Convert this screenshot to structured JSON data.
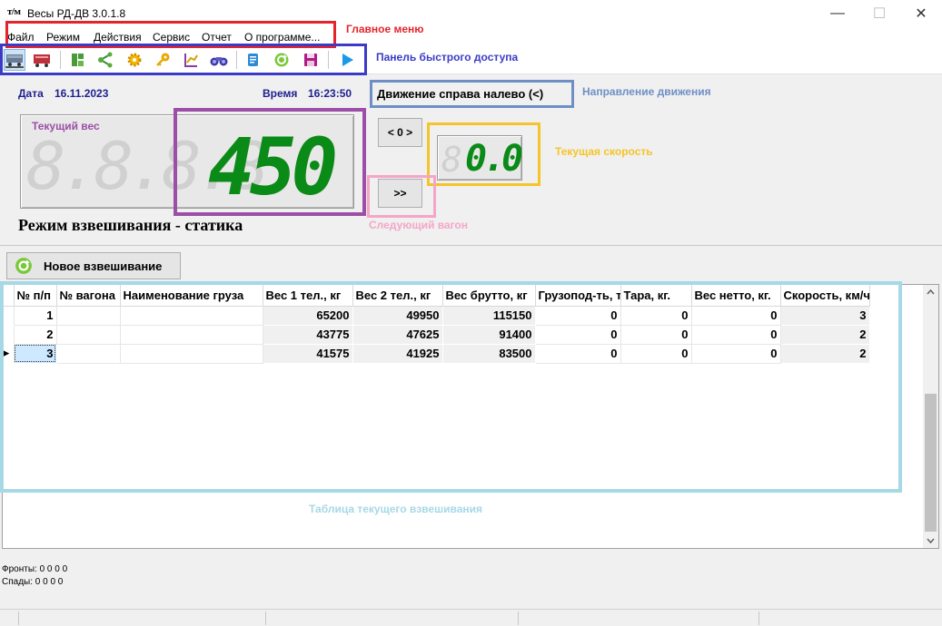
{
  "window": {
    "app_icon_text": "т/м",
    "title": "Весы РД-ДВ 3.0.1.8",
    "minimize": "—",
    "maximize": "☐",
    "close": "✕"
  },
  "menu": [
    "Файл",
    "Режим",
    "Действия",
    "Сервис",
    "Отчет",
    "О программе..."
  ],
  "toolbar": {
    "icons": [
      "scales-icon",
      "wagon-icon",
      "tree-icon",
      "share-icon",
      "gear-icon",
      "key-icon",
      "chart-icon",
      "binoculars-icon",
      "scroll-icon",
      "refresh-icon",
      "save-icon",
      "play-icon"
    ]
  },
  "annotations": {
    "main_menu": "Главное меню",
    "quick_access": "Панель быстрого доступа",
    "direction": "Направление движения",
    "current_weight": "Текущий вес",
    "current_speed": "Текущая скорость",
    "next_wagon": "Следующий вагон",
    "table": "Таблица текущего взвешивания"
  },
  "colors": {
    "main_menu": "#e3242b",
    "quick_access": "#3b3bc8",
    "direction": "#6f8fc4",
    "current_weight": "#9b4fa6",
    "current_speed": "#f5c42a",
    "next_wagon": "#f4a6c6",
    "table": "#a6d8e6",
    "lcd_green": "#0a8a16"
  },
  "info": {
    "date_label": "Дата",
    "date_value": "16.11.2023",
    "time_label": "Время",
    "time_value": "16:23:50",
    "direction_text": "Движение справа налево (<)"
  },
  "weight_display": {
    "ghost": "8.8.8.8.",
    "value": "450"
  },
  "speed_display": {
    "ghost": "8",
    "value": "0.0"
  },
  "buttons": {
    "zero": "< 0 >",
    "next": ">>",
    "new_weighing": "Новое взвешивание"
  },
  "mode_text": "Режим взвешивания - статика",
  "table": {
    "columns": [
      "№ п/п",
      "№ вагона",
      "Наименование груза",
      "Вес 1 тел., кг",
      "Вес 2 тел., кг",
      "Вес брутто, кг",
      "Грузопод-ть, т",
      "Тара, кг.",
      "Вес нетто, кг.",
      "Скорость, км/ч"
    ],
    "rows": [
      [
        "1",
        "",
        "",
        "65200",
        "49950",
        "115150",
        "0",
        "0",
        "0",
        "3"
      ],
      [
        "2",
        "",
        "",
        "43775",
        "47625",
        "91400",
        "0",
        "0",
        "0",
        "2"
      ],
      [
        "3",
        "",
        "",
        "41575",
        "41925",
        "83500",
        "0",
        "0",
        "0",
        "2"
      ]
    ],
    "current_row_marker": "▶"
  },
  "status": {
    "fronts": "Фронты: 0 0 0 0",
    "falls": "Спады: 0 0 0 0"
  }
}
